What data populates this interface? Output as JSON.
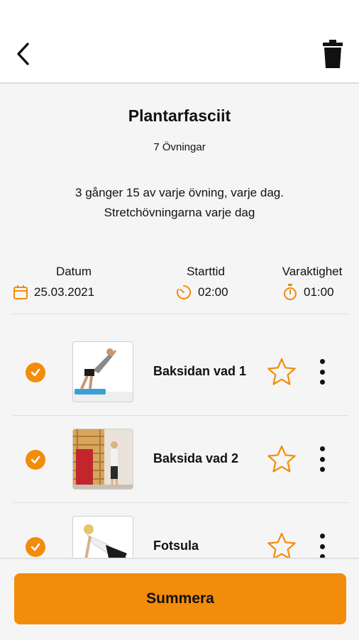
{
  "colors": {
    "accent": "#f28c0a",
    "background": "#f5f5f5",
    "text": "#111111"
  },
  "header": {
    "back_icon": "chevron-left-icon",
    "delete_icon": "trash-icon"
  },
  "program": {
    "title": "Plantarfasciit",
    "exercise_count": "7 Övningar",
    "description_line1": "3 gånger 15 av varje övning, varje dag.",
    "description_line2": "Stretchövningarna varje dag"
  },
  "meta": {
    "date_label": "Datum",
    "date_value": "25.03.2021",
    "start_label": "Starttid",
    "start_value": "02:00",
    "duration_label": "Varaktighet",
    "duration_value": "01:00"
  },
  "exercises": [
    {
      "name": "Baksidan vad 1",
      "completed": true,
      "favorite": false
    },
    {
      "name": "Baksida vad 2",
      "completed": true,
      "favorite": false
    },
    {
      "name": "Fotsula",
      "completed": true,
      "favorite": false
    }
  ],
  "footer": {
    "summarize_label": "Summera"
  }
}
